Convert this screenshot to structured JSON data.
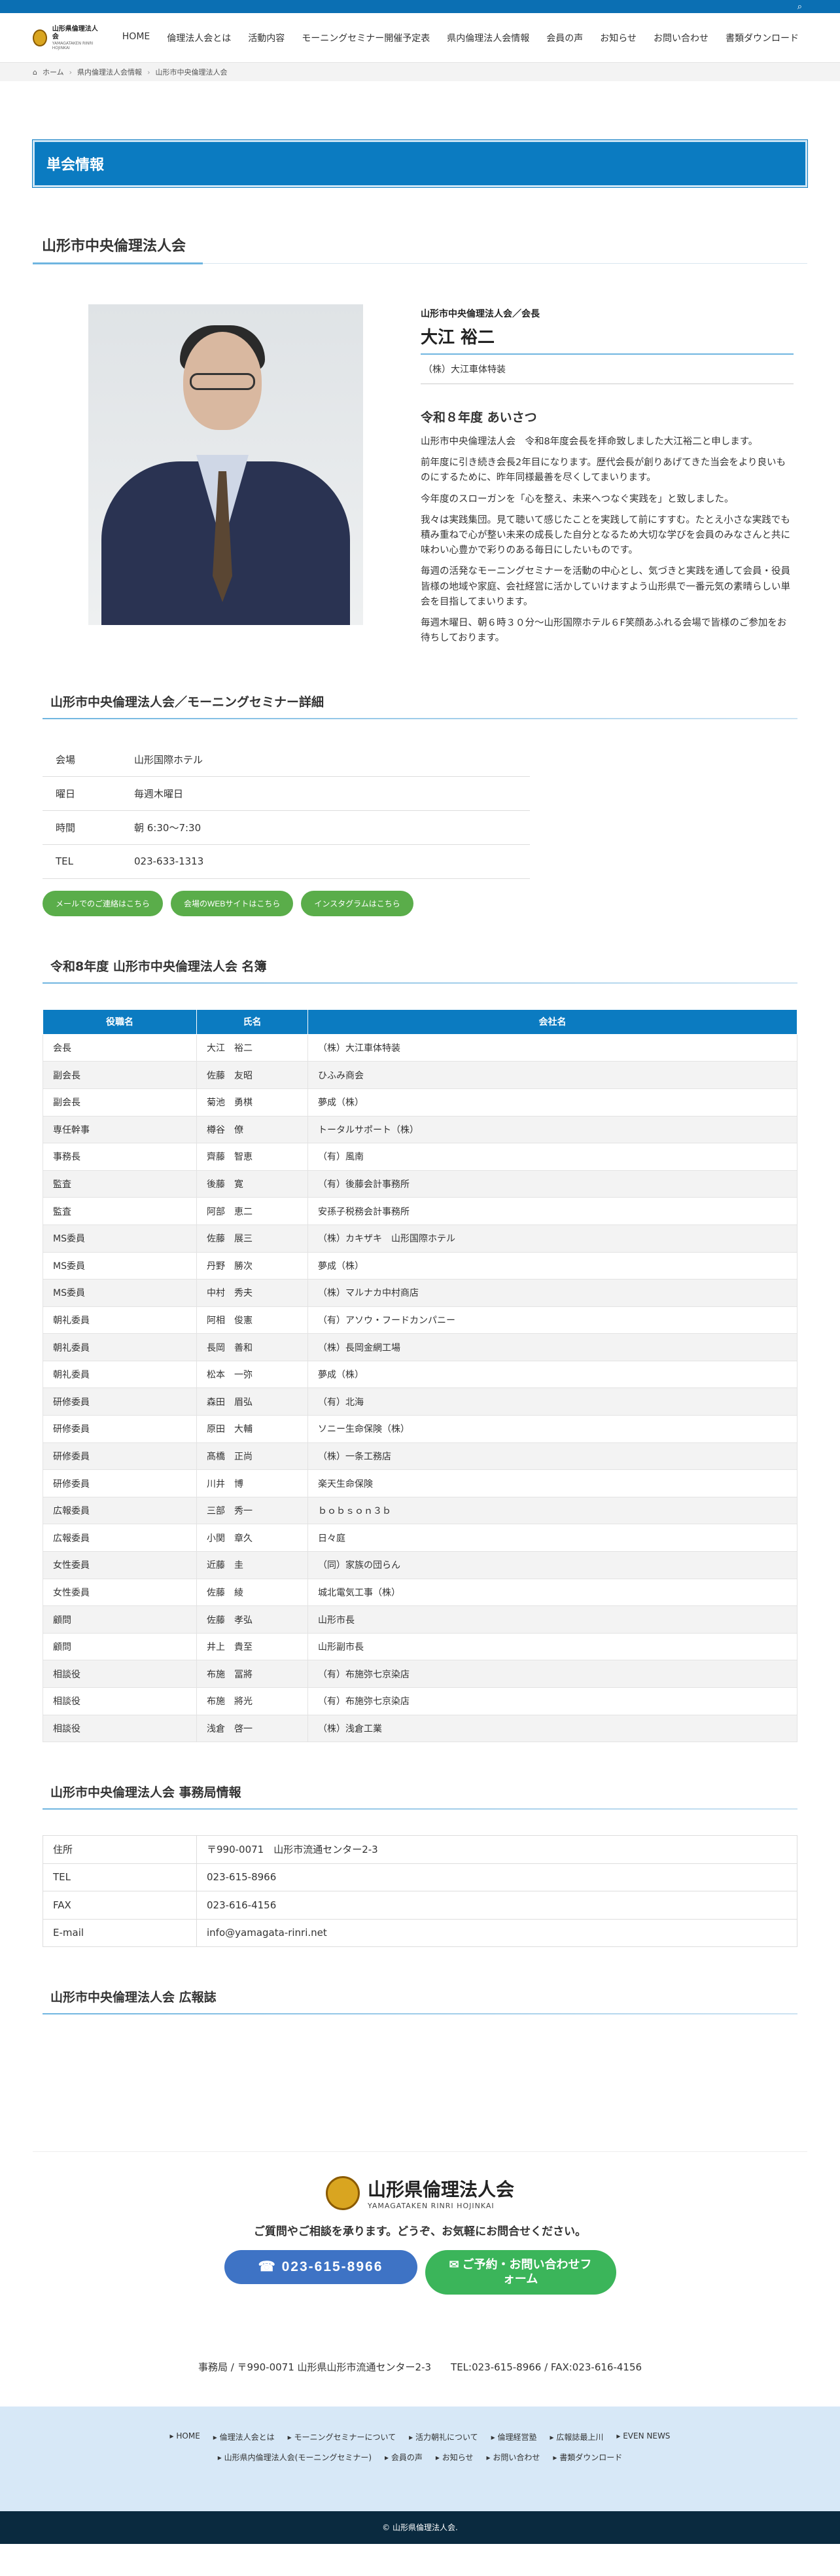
{
  "header": {
    "logo_title": "山形県倫理法人会",
    "logo_sub": "YAMAGATAKEN RINRI HOJINKAI",
    "nav": [
      "HOME",
      "倫理法人会とは",
      "活動内容",
      "モーニングセミナー開催予定表",
      "県内倫理法人会情報",
      "会員の声",
      "お知らせ",
      "お問い合わせ",
      "書類ダウンロード"
    ]
  },
  "breadcrumb": [
    "ホーム",
    "県内倫理法人会情報",
    "山形市中央倫理法人会"
  ],
  "page_title": "単会情報",
  "branch_title": "山形市中央倫理法人会",
  "profile": {
    "role": "山形市中央倫理法人会／会長",
    "name": "大江 裕二",
    "company": "（株）大江車体特装",
    "greeting_title": "令和８年度 あいさつ",
    "paragraphs": [
      "山形市中央倫理法人会　令和8年度会長を拝命致しました大江裕二と申します。",
      "前年度に引き続き会長2年目になります。歴代会長が創りあげてきた当会をより良いものにするために、昨年同様最善を尽くしてまいります。",
      "今年度のスローガンを「心を整え、未来へつなぐ実践を」と致しました。",
      "我々は実践集団。見て聴いて感じたことを実践して前にすすむ。たとえ小さな実践でも積み重ねで心が整い未来の成長した自分となるため大切な学びを会員のみなさんと共に味わい心豊かで彩りのある毎日にしたいものです。",
      "毎週の活発なモーニングセミナーを活動の中心とし、気づきと実践を通して会員・役員皆様の地域や家庭、会社経営に活かしていけますよう山形県で一番元気の素晴らしい単会を目指してまいります。",
      "毎週木曜日、朝６時３０分〜山形国際ホテル６F笑顔あふれる会場で皆様のご参加をお待ちしております。"
    ]
  },
  "seminar": {
    "title": "山形市中央倫理法人会／モーニングセミナー詳細",
    "rows": [
      {
        "k": "会場",
        "v": "山形国際ホテル"
      },
      {
        "k": "曜日",
        "v": "毎週木曜日"
      },
      {
        "k": "時間",
        "v": "朝 6:30〜7:30"
      },
      {
        "k": "TEL",
        "v": "023-633-1313"
      }
    ],
    "buttons": [
      "メールでのご連絡はこちら",
      "会場のWEBサイトはこちら",
      "インスタグラムはこちら"
    ]
  },
  "roster": {
    "title": "令和8年度 山形市中央倫理法人会 名簿",
    "headers": [
      "役職名",
      "氏名",
      "会社名"
    ],
    "rows": [
      [
        "会長",
        "大江　裕二",
        "（株）大江車体特装"
      ],
      [
        "副会長",
        "佐藤　友昭",
        "ひふみ商会"
      ],
      [
        "副会長",
        "菊池　勇棋",
        "夢成（株）"
      ],
      [
        "専任幹事",
        "樽谷　僚",
        "トータルサポート（株）"
      ],
      [
        "事務長",
        "齊藤　智恵",
        "（有）風南"
      ],
      [
        "監査",
        "後藤　寛",
        "（有）後藤会計事務所"
      ],
      [
        "監査",
        "阿部　恵二",
        "安孫子税務会計事務所"
      ],
      [
        "MS委員",
        "佐藤　展三",
        "（株）カキザキ　山形国際ホテル"
      ],
      [
        "MS委員",
        "丹野　勝次",
        "夢成（株）"
      ],
      [
        "MS委員",
        "中村　秀夫",
        "（株）マルナカ中村商店"
      ],
      [
        "朝礼委員",
        "阿相　俊憲",
        "（有）アソウ・フードカンパニー"
      ],
      [
        "朝礼委員",
        "長岡　善和",
        "（株）長岡金網工場"
      ],
      [
        "朝礼委員",
        "松本　一弥",
        "夢成（株）"
      ],
      [
        "研修委員",
        "森田　眉弘",
        "（有）北海"
      ],
      [
        "研修委員",
        "原田　大輔",
        "ソニー生命保険（株）"
      ],
      [
        "研修委員",
        "髙橋　正尚",
        "（株）一条工務店"
      ],
      [
        "研修委員",
        "川井　博",
        "楽天生命保険"
      ],
      [
        "広報委員",
        "三部　秀一",
        "ｂｏｂｓｏｎ３ｂ"
      ],
      [
        "広報委員",
        "小関　章久",
        "日々庭"
      ],
      [
        "女性委員",
        "近藤　圭",
        "（同）家族の団らん"
      ],
      [
        "女性委員",
        "佐藤　綾",
        "城北電気工事（株）"
      ],
      [
        "顧問",
        "佐藤　孝弘",
        "山形市長"
      ],
      [
        "顧問",
        "井上　貴至",
        "山形副市長"
      ],
      [
        "相談役",
        "布施　冨將",
        "（有）布施弥七京染店"
      ],
      [
        "相談役",
        "布施　將光",
        "（有）布施弥七京染店"
      ],
      [
        "相談役",
        "浅倉　啓一",
        "（株）浅倉工業"
      ]
    ]
  },
  "office": {
    "title": "山形市中央倫理法人会 事務局情報",
    "rows": [
      {
        "k": "住所",
        "v": "〒990-0071　山形市流通センター2-3"
      },
      {
        "k": "TEL",
        "v": "023-615-8966"
      },
      {
        "k": "FAX",
        "v": "023-616-4156"
      },
      {
        "k": "E-mail",
        "v": "info@yamagata-rinri.net"
      }
    ]
  },
  "pr_title": "山形市中央倫理法人会 広報誌",
  "footer": {
    "logo_title": "山形県倫理法人会",
    "logo_sub": "YAMAGATAKEN RINRI HOJINKAI",
    "message": "ご質問やご相談を承ります。どうぞ、お気軽にお問合せください。",
    "tel_button": "023-615-8966",
    "mail_button": "ご予約・お問い合わせフォーム",
    "address": "事務局 / 〒990-0071 山形県山形市流通センター2-3　　TEL:023-615-8966 / FAX:023-616-4156",
    "nav1": [
      "HOME",
      "倫理法人会とは",
      "モーニングセミナーについて",
      "活力朝礼について",
      "倫理経営塾",
      "広報誌最上川",
      "EVEN NEWS"
    ],
    "nav2": [
      "山形県内倫理法人会(モーニングセミナー)",
      "会員の声",
      "お知らせ",
      "お問い合わせ",
      "書類ダウンロード"
    ],
    "copyright": "© 山形県倫理法人会."
  }
}
